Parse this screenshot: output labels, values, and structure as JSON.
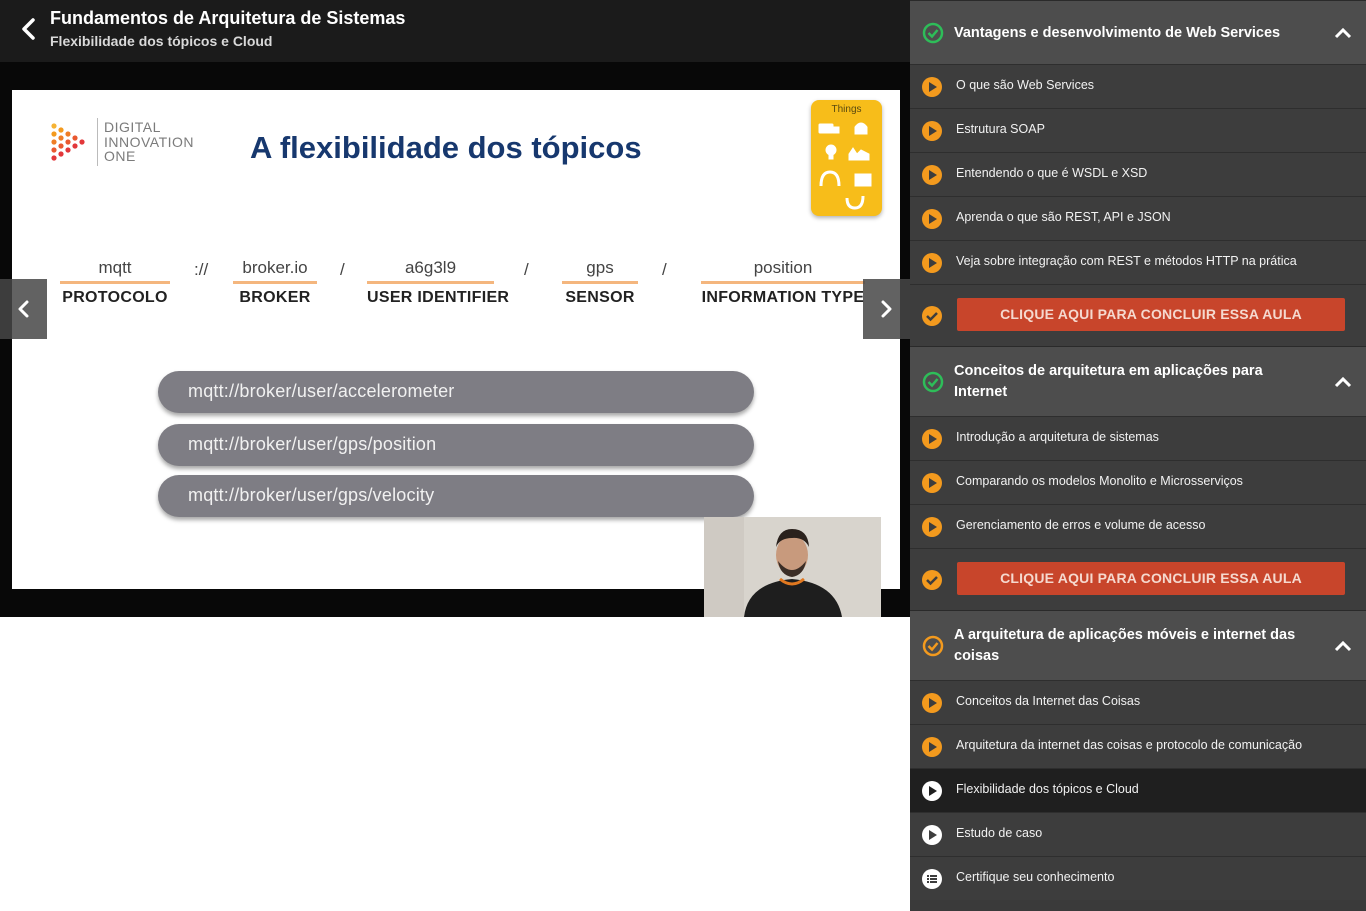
{
  "header": {
    "course_title": "Fundamentos de Arquitetura de Sistemas",
    "lesson_subtitle": "Flexibilidade dos tópicos e Cloud"
  },
  "slide": {
    "logo_text": "DIGITAL INNOVATION ONE",
    "title": "A flexibilidade dos tópicos",
    "things_label": "Things",
    "topic_parts": [
      {
        "value": "mqtt",
        "label": "PROTOCOLO"
      },
      {
        "value": "broker.io",
        "label": "BROKER"
      },
      {
        "value": "a6g3l9",
        "label": "USER IDENTIFIER"
      },
      {
        "value": "gps",
        "label": "SENSOR"
      },
      {
        "value": "position",
        "label": "INFORMATION TYPE"
      }
    ],
    "separators": [
      "://",
      "/",
      "/",
      "/"
    ],
    "paths": [
      "mqtt://broker/user/accelerometer",
      "mqtt://broker/user/gps/position",
      "mqtt://broker/user/gps/velocity"
    ]
  },
  "sidebar": {
    "modules": [
      {
        "title": "Vantagens e desenvolvimento de Web Services",
        "status": "complete",
        "lessons": [
          "O que são Web Services",
          "Estrutura SOAP",
          "Entendendo o que é WSDL e XSD",
          "Aprenda o que são REST, API e JSON",
          "Veja sobre integração com REST e métodos HTTP na prática"
        ],
        "conclude_label": "CLIQUE AQUI PARA CONCLUIR ESSA AULA"
      },
      {
        "title": "Conceitos de arquitetura em aplicações para Internet",
        "status": "complete",
        "lessons": [
          "Introdução a arquitetura de sistemas",
          "Comparando os modelos Monolito e Microsserviços",
          "Gerenciamento de erros e volume de acesso"
        ],
        "conclude_label": "CLIQUE AQUI PARA CONCLUIR ESSA AULA"
      },
      {
        "title": "A arquitetura de aplicações móveis e internet das coisas",
        "status": "in-progress",
        "lessons": [
          "Conceitos da Internet das Coisas",
          "Arquitetura da internet das coisas e protocolo de comunicação",
          "Flexibilidade dos tópicos e Cloud",
          "Estudo de caso",
          "Certifique seu conhecimento"
        ]
      }
    ]
  },
  "colors": {
    "accent_orange": "#f39a1e",
    "complete_green": "#2ebd59",
    "button_red": "#c8452b",
    "slide_title_blue": "#17386e"
  }
}
